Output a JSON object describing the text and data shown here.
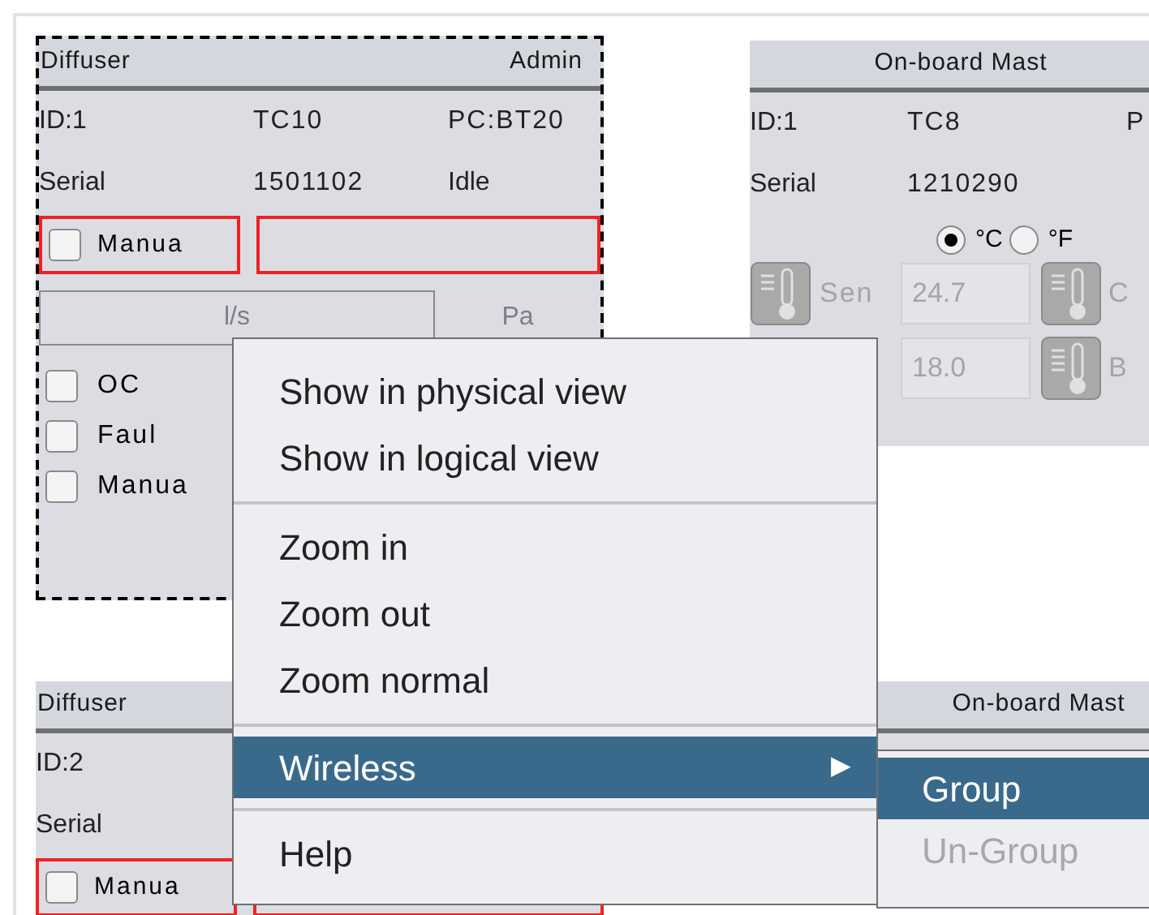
{
  "panels": [
    {
      "kind": "diffuser",
      "title": "Diffuser",
      "title_right": "Admin",
      "selected": true,
      "id": "ID:1",
      "model": "TC10",
      "pc": "PC:BT20",
      "serial_label": "Serial",
      "serial": "1501102",
      "status": "Idle",
      "manual": {
        "label": "Manua",
        "checked": false
      },
      "buttons": [
        "l/s",
        "Pa"
      ],
      "checks": [
        {
          "label": "OC",
          "checked": false
        },
        {
          "label": "Faul",
          "checked": false
        },
        {
          "label": "Manua",
          "checked": false
        }
      ]
    },
    {
      "kind": "master",
      "title": "On-board Mast",
      "selected": false,
      "id": "ID:1",
      "model": "TC8",
      "pc": "P",
      "serial_label": "Serial",
      "serial": "1210290",
      "units": [
        {
          "label": "°C",
          "selected": true
        },
        {
          "label": "°F",
          "selected": false
        }
      ],
      "sensors": [
        {
          "label": "Sen",
          "value": "24.7",
          "right": "C"
        },
        {
          "value": "18.0",
          "right": "B"
        }
      ]
    },
    {
      "kind": "diffuser",
      "title": "Diffuser",
      "selected": false,
      "id": "ID:2",
      "serial_label": "Serial",
      "manual": {
        "label": "Manua",
        "checked": false
      }
    },
    {
      "kind": "master",
      "title": "On-board Mast",
      "selected": false
    }
  ],
  "menu": [
    {
      "kind": "item",
      "label": "Show in physical view"
    },
    {
      "kind": "item",
      "label": "Show in logical view"
    },
    {
      "kind": "separator"
    },
    {
      "kind": "item",
      "label": "Zoom in"
    },
    {
      "kind": "item",
      "label": "Zoom out"
    },
    {
      "kind": "item",
      "label": "Zoom normal"
    },
    {
      "kind": "separator"
    },
    {
      "kind": "submenu",
      "label": "Wireless",
      "arrow": "▶",
      "selected": true
    },
    {
      "kind": "separator"
    },
    {
      "kind": "item",
      "label": "Help"
    }
  ],
  "submenu": [
    {
      "label": "Group",
      "selected": true,
      "disabled": false
    },
    {
      "label": "Un-Group",
      "selected": false,
      "disabled": true
    }
  ]
}
